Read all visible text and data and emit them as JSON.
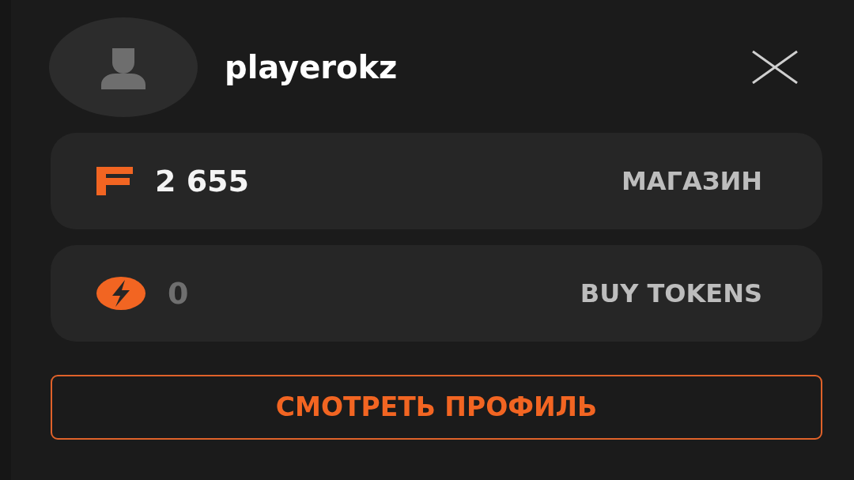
{
  "user": {
    "username": "playerokz"
  },
  "balances": [
    {
      "kind": "coins",
      "amount": "2 655",
      "action": "МАГАЗИН",
      "empty": false
    },
    {
      "kind": "tokens",
      "amount": "0",
      "action": "BUY TOKENS",
      "empty": true
    }
  ],
  "profile_button": {
    "label": "СМОТРЕТЬ ПРОФИЛЬ"
  }
}
